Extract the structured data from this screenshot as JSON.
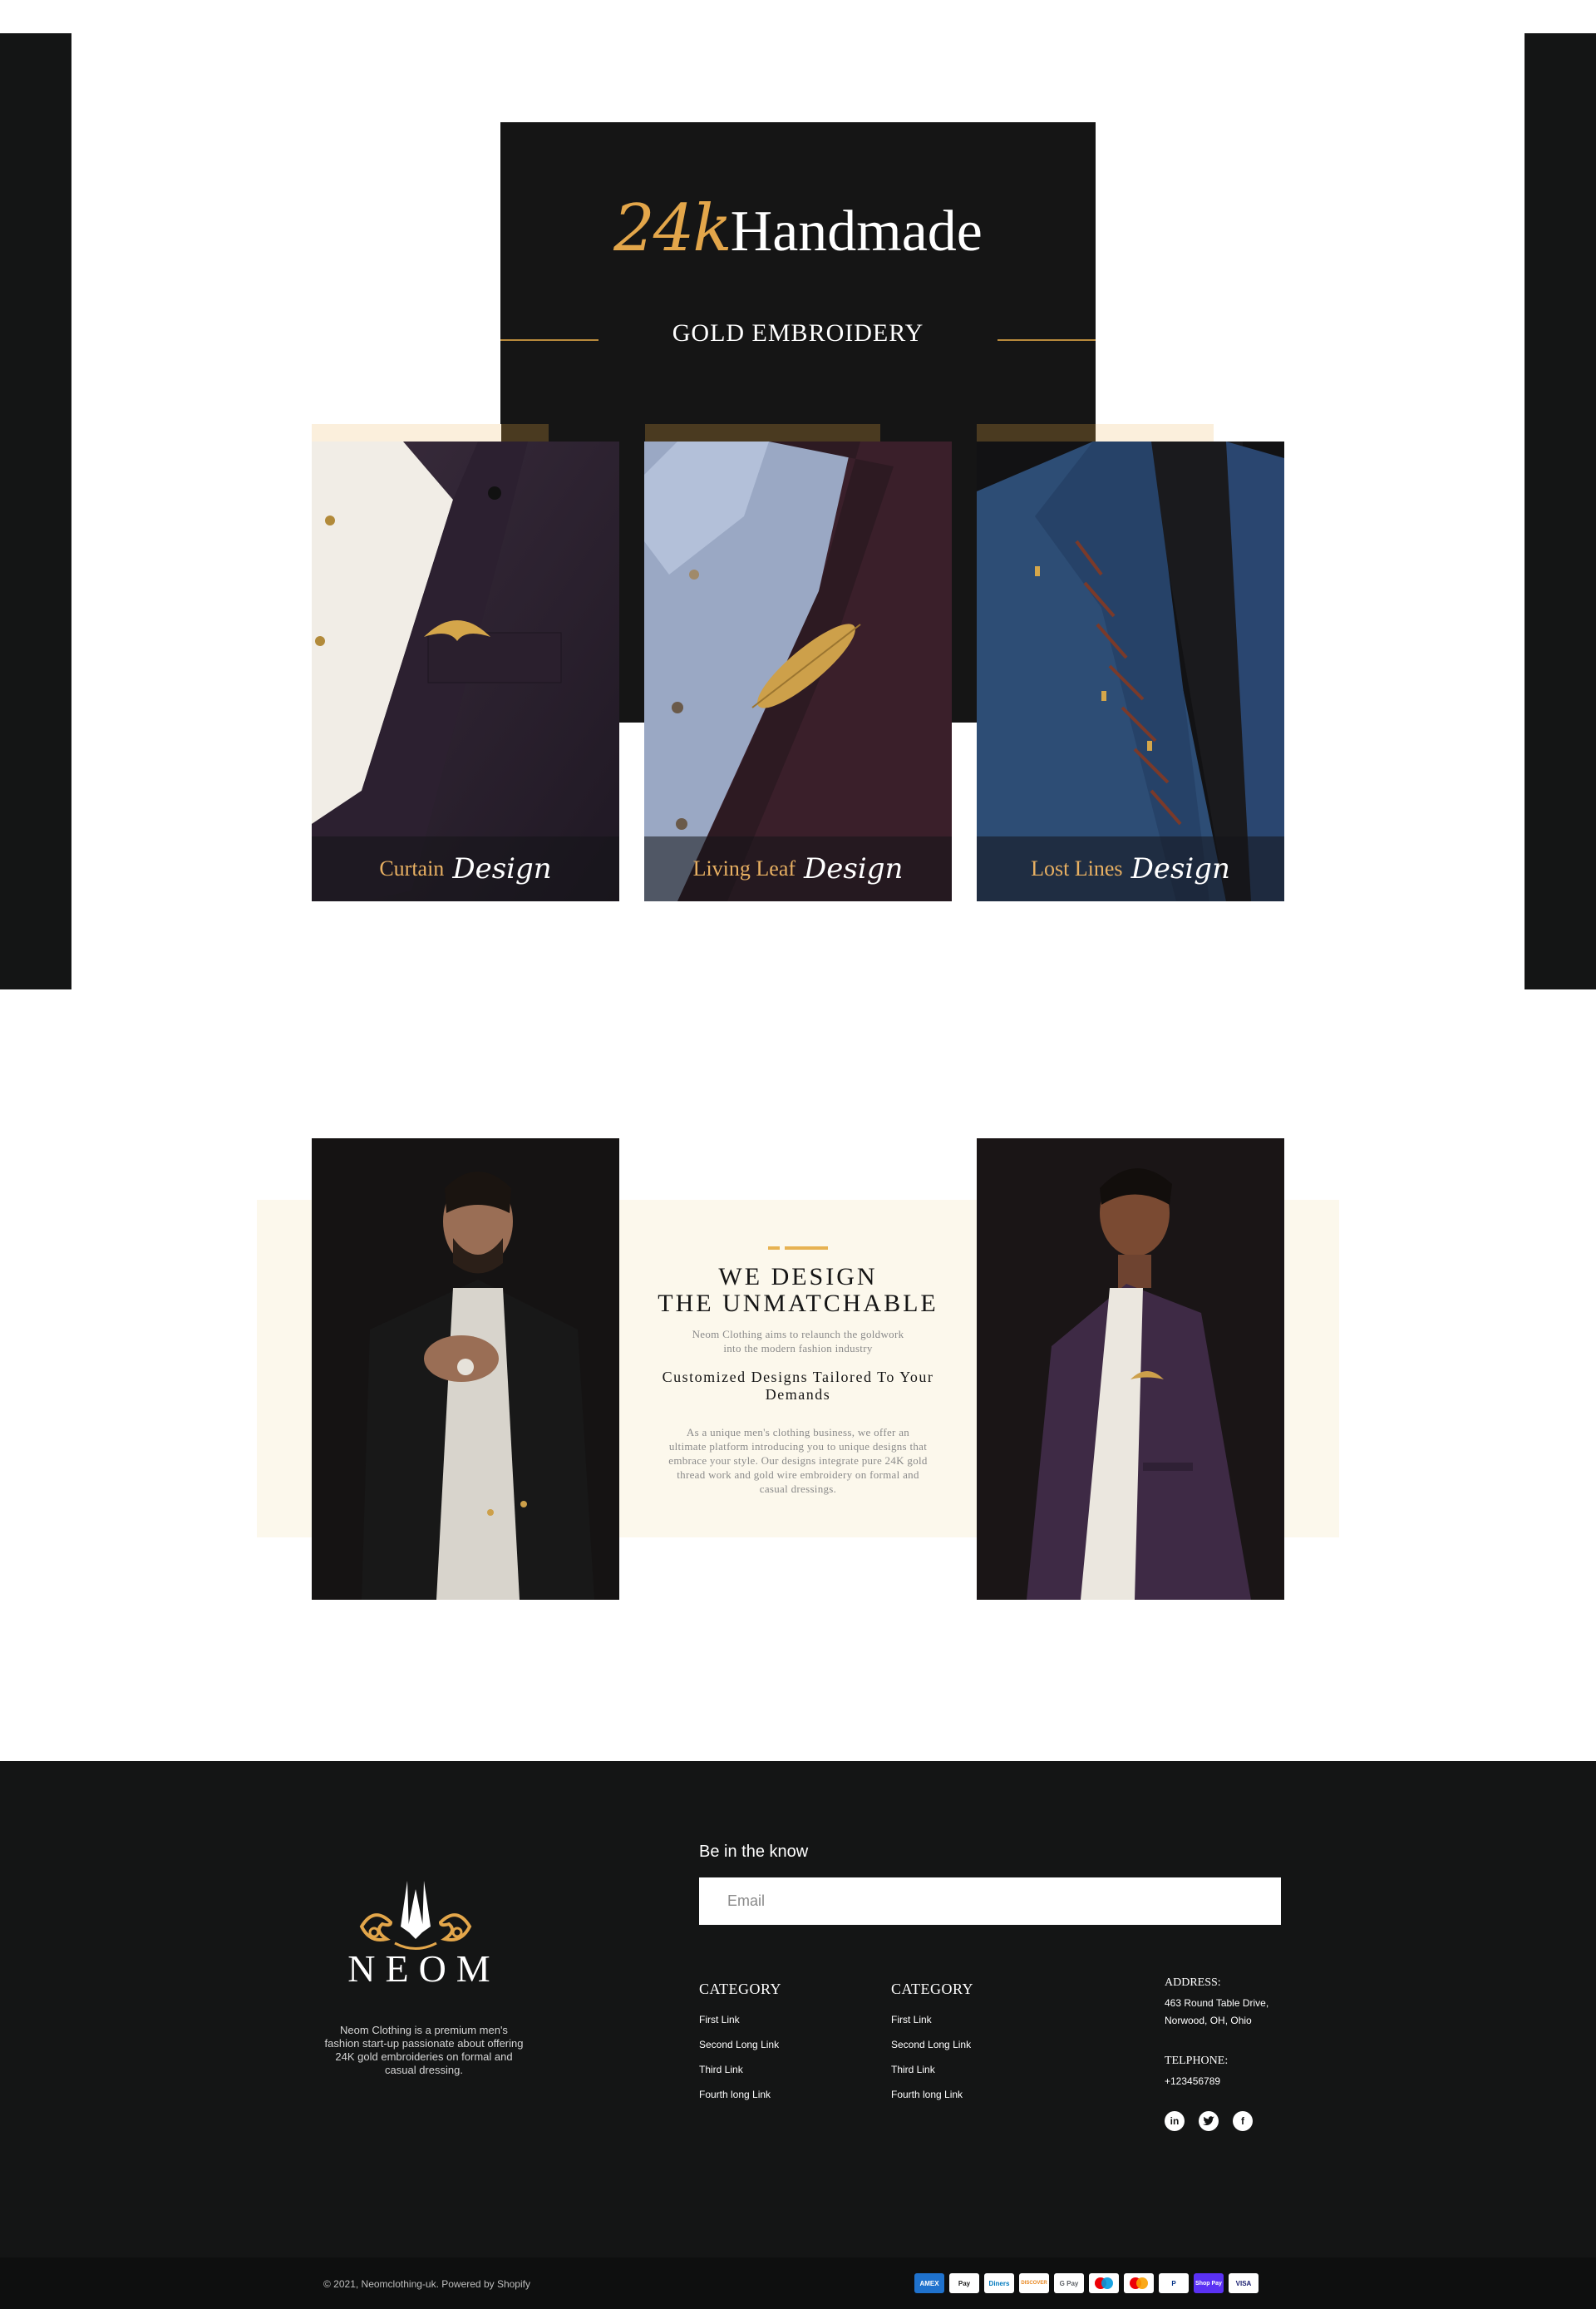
{
  "hero": {
    "script_text": "24k",
    "title": "Handmade",
    "subtitle": "GOLD EMBROIDERY"
  },
  "products": [
    {
      "name": "Curtain",
      "script": "Design"
    },
    {
      "name": "Living Leaf",
      "script": "Design"
    },
    {
      "name": "Lost Lines",
      "script": "Design"
    }
  ],
  "about": {
    "heading_line1": "WE DESIGN",
    "heading_line2": "THE UNMATCHABLE",
    "intro_line1": "Neom Clothing aims to relaunch the goldwork",
    "intro_line2": "into the modern fashion industry",
    "subheading_line1": "Customized Designs Tailored To Your",
    "subheading_line2": "Demands",
    "body_line1": "As a unique men's clothing business, we offer an",
    "body_line2": "ultimate platform introducing you to unique designs that",
    "body_line3": "embrace your style. Our designs integrate pure 24K gold",
    "body_line4": "thread work and gold wire embroidery on formal and",
    "body_line5": "casual dressings."
  },
  "footer": {
    "brand": "NEOM",
    "description_line1": "Neom Clothing is a premium men's",
    "description_line2": "fashion start-up passionate about offering",
    "description_line3": "24K gold embroideries on formal and",
    "description_line4": "casual dressing.",
    "newsletter_title": "Be in the know",
    "email_placeholder": "Email",
    "columns": [
      {
        "title": "CATEGORY",
        "links": [
          "First Link",
          "Second Long Link",
          "Third Link",
          "Fourth long Link"
        ]
      },
      {
        "title": "CATEGORY",
        "links": [
          "First Link",
          "Second Long Link",
          "Third Link",
          "Fourth long Link"
        ]
      }
    ],
    "address_label": "ADDRESS:",
    "address_line1": "463 Round Table Drive,",
    "address_line2": "Norwood, OH, Ohio",
    "phone_label": "TELPHONE:",
    "phone": "+123456789",
    "socials": [
      "linkedin-icon",
      "twitter-icon",
      "facebook-icon"
    ],
    "copyright": "© 2021, Neomclothing-uk. Powered by Shopify",
    "payments": [
      "AMEX",
      "Pay",
      "Diners",
      "DISCOVER",
      "G Pay",
      "Maestro",
      "Mastercard",
      "PayPal",
      "Shop Pay",
      "VISA"
    ]
  },
  "colors": {
    "gold": "#e3a64a",
    "dark": "#141515",
    "cream": "#fcf8ec",
    "accent_beige": "#fbefdc",
    "accent_brown": "#4a3a20"
  }
}
